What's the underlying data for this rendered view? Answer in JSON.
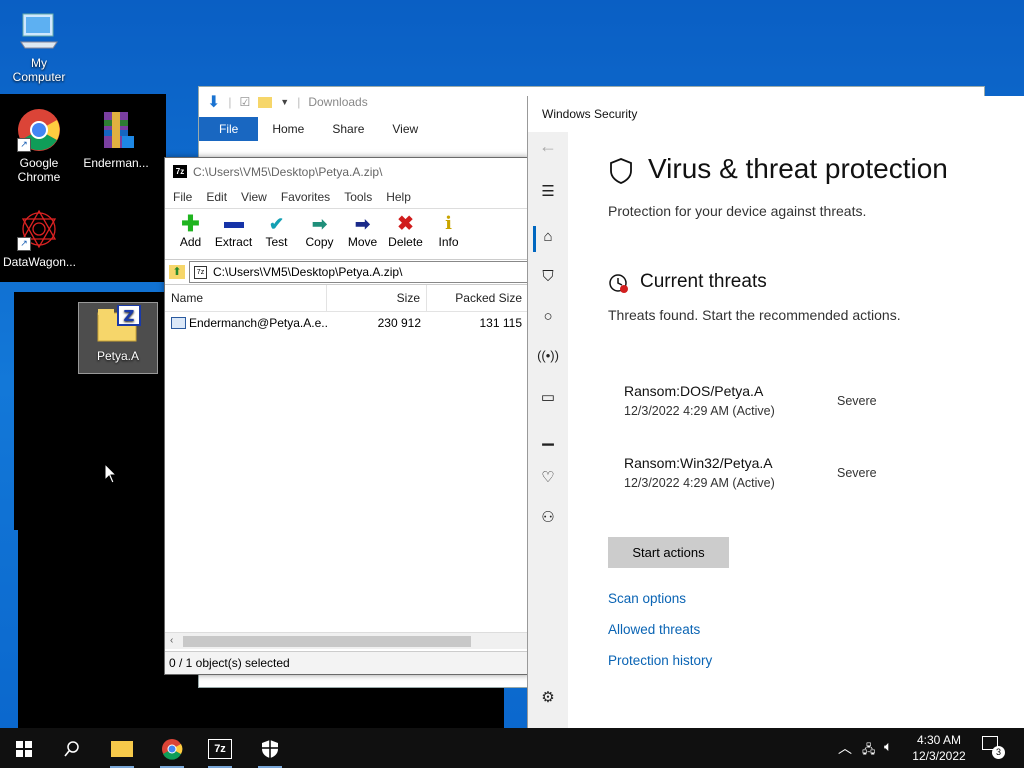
{
  "desktop": {
    "icons": [
      {
        "label": "My Computer",
        "icon": "computer-icon"
      },
      {
        "label": "Google Chrome",
        "icon": "chrome-icon"
      },
      {
        "label": "Enderman...",
        "icon": "winrar-icon"
      },
      {
        "label": "DataWagon...",
        "icon": "datawagon-icon"
      },
      {
        "label": "Petya.A",
        "icon": "7zip-archive-icon"
      }
    ]
  },
  "explorer": {
    "title": "Downloads",
    "tabs": [
      "File",
      "Home",
      "Share",
      "View"
    ]
  },
  "zip": {
    "title": "C:\\Users\\VM5\\Desktop\\Petya.A.zip\\",
    "menu": [
      "File",
      "Edit",
      "View",
      "Favorites",
      "Tools",
      "Help"
    ],
    "toolbar": [
      "Add",
      "Extract",
      "Test",
      "Copy",
      "Move",
      "Delete",
      "Info"
    ],
    "path": "C:\\Users\\VM5\\Desktop\\Petya.A.zip\\",
    "columns": [
      "Name",
      "Size",
      "Packed Size"
    ],
    "rows": [
      {
        "name": "Endermanch@Petya.A.e...",
        "size": "230 912",
        "packed": "131 115"
      }
    ],
    "status": "0 / 1 object(s) selected"
  },
  "security": {
    "window_title": "Windows Security",
    "heading": "Virus & threat protection",
    "subheading": "Protection for your device against threats.",
    "section_title": "Current threats",
    "section_sub": "Threats found. Start the recommended actions.",
    "threats": [
      {
        "name": "Ransom:DOS/Petya.A",
        "time": "12/3/2022 4:29 AM (Active)",
        "severity": "Severe"
      },
      {
        "name": "Ransom:Win32/Petya.A",
        "time": "12/3/2022 4:29 AM (Active)",
        "severity": "Severe"
      }
    ],
    "button": "Start actions",
    "links": [
      "Scan options",
      "Allowed threats",
      "Protection history"
    ]
  },
  "taskbar": {
    "time": "4:30 AM",
    "date": "12/3/2022",
    "notifications": "3"
  }
}
